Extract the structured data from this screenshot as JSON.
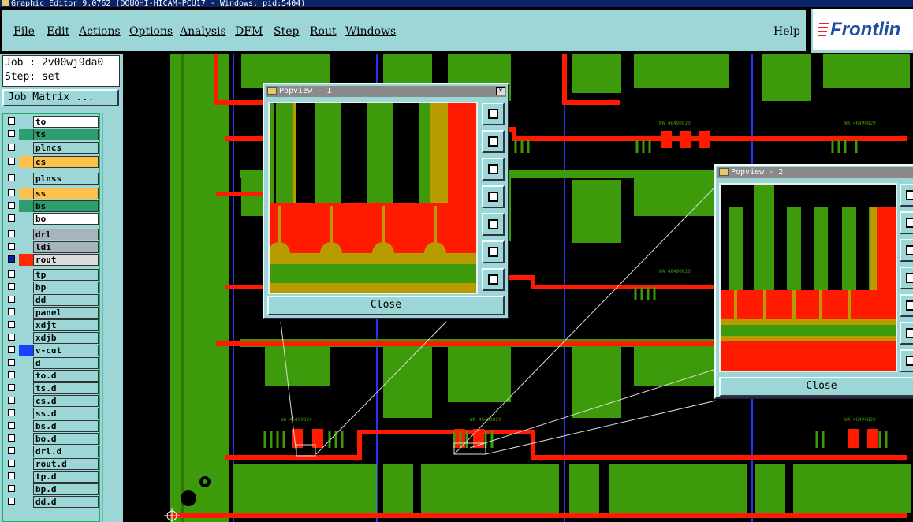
{
  "window": {
    "title": "Graphic Editor 9.0762 (DOUQHI-HICAM-PCU17 - Windows, pid:5404)"
  },
  "menu": {
    "items": [
      "File",
      "Edit",
      "Actions",
      "Options",
      "Analysis",
      "DFM",
      "Step",
      "Rout",
      "Windows"
    ],
    "help": "Help"
  },
  "logo": {
    "text": "Frontlin"
  },
  "job": {
    "line1": "Job : 2v00wj9da0",
    "line2": "Step: set",
    "matrix_button": "Job Matrix ..."
  },
  "layers": [
    {
      "name": "to",
      "color": "#ffffff"
    },
    {
      "name": "ts",
      "color": "#2e9e6e"
    },
    {
      "name": "plncs",
      "color": "#9cd6d6"
    },
    {
      "name": "cs",
      "color": "#ffc04a"
    },
    {
      "name": "plnss",
      "color": "#9cd6d6"
    },
    {
      "name": "ss",
      "color": "#ffc04a"
    },
    {
      "name": "bs",
      "color": "#2e9e6e"
    },
    {
      "name": "bo",
      "color": "#ffffff"
    },
    {
      "name": "drl",
      "color": "#a8b4bc"
    },
    {
      "name": "ldi",
      "color": "#a8b4bc"
    },
    {
      "name": "rout",
      "color": "#dddddd"
    },
    {
      "name": "tp",
      "color": "#9cd6d6"
    },
    {
      "name": "bp",
      "color": "#9cd6d6"
    },
    {
      "name": "dd",
      "color": "#9cd6d6"
    },
    {
      "name": "panel",
      "color": "#9cd6d6"
    },
    {
      "name": "xdjt",
      "color": "#9cd6d6"
    },
    {
      "name": "xdjb",
      "color": "#9cd6d6"
    },
    {
      "name": "v-cut",
      "color": "#9cd6d6"
    },
    {
      "name": "d",
      "color": "#9cd6d6"
    },
    {
      "name": "to.d",
      "color": "#9cd6d6"
    },
    {
      "name": "ts.d",
      "color": "#9cd6d6"
    },
    {
      "name": "cs.d",
      "color": "#9cd6d6"
    },
    {
      "name": "ss.d",
      "color": "#9cd6d6"
    },
    {
      "name": "bs.d",
      "color": "#9cd6d6"
    },
    {
      "name": "bo.d",
      "color": "#9cd6d6"
    },
    {
      "name": "drl.d",
      "color": "#9cd6d6"
    },
    {
      "name": "rout.d",
      "color": "#9cd6d6"
    },
    {
      "name": "tp.d",
      "color": "#9cd6d6"
    },
    {
      "name": "bp.d",
      "color": "#9cd6d6"
    },
    {
      "name": "dd.d",
      "color": "#9cd6d6"
    }
  ],
  "popup1": {
    "title": "Popview - 1",
    "close": "Close"
  },
  "popup2": {
    "title": "Popview - 2",
    "close": "Close"
  },
  "colors": {
    "copper_green": "#3d9a0a",
    "red": "#ff1a00",
    "gold": "#b89b00",
    "teal": "#9cd6d6",
    "blue_line": "#2233ff"
  },
  "pcb_label": "WA 46490820"
}
